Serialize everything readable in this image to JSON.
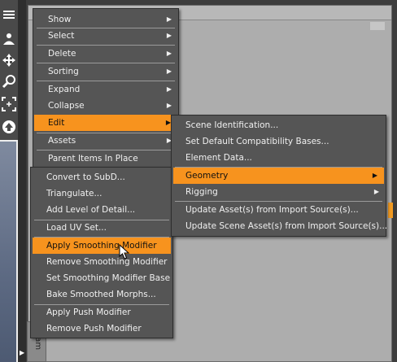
{
  "colors": {
    "menu_bg": "#555555",
    "highlight": "#f7931e",
    "pane_bg": "#adadad"
  },
  "toolbar": {
    "icons": [
      "list-icon",
      "user-move-icon",
      "move-arrows-icon",
      "zoom-icon",
      "frame-icon",
      "up-arrow-icon"
    ]
  },
  "side_tab": {
    "label": "aram"
  },
  "main_menu": {
    "items": [
      {
        "label": "Show",
        "submenu": true
      },
      {
        "label": "Select",
        "submenu": true
      },
      {
        "label": "Delete",
        "submenu": true
      },
      {
        "label": "Sorting",
        "submenu": true
      },
      {
        "label": "Expand",
        "submenu": true
      },
      {
        "label": "Collapse",
        "submenu": true
      },
      {
        "label": "Edit",
        "submenu": true,
        "highlighted": true
      },
      {
        "label": "Assets",
        "submenu": true
      },
      {
        "label": "Parent Items In Place",
        "submenu": false
      }
    ]
  },
  "lower_menu": {
    "items": [
      {
        "label": "Convert to SubD..."
      },
      {
        "label": "Triangulate..."
      },
      {
        "label": "Add Level of Detail..."
      },
      {
        "label": "Load UV Set..."
      },
      {
        "label": "Apply Smoothing Modifier",
        "highlighted": true
      },
      {
        "label": "Remove Smoothing Modifier"
      },
      {
        "label": "Set Smoothing Modifier Base"
      },
      {
        "label": "Bake Smoothed Morphs..."
      },
      {
        "label": "Apply Push Modifier"
      },
      {
        "label": "Remove Push Modifier"
      }
    ]
  },
  "edit_submenu": {
    "items": [
      {
        "label": "Scene Identification..."
      },
      {
        "label": "Set Default Compatibility Bases..."
      },
      {
        "label": "Element Data..."
      },
      {
        "label": "Geometry",
        "submenu": true,
        "highlighted": true
      },
      {
        "label": "Rigging",
        "submenu": true
      },
      {
        "label": "Update Asset(s) from Import Source(s)..."
      },
      {
        "label": "Update Scene Asset(s) from Import Source(s)..."
      }
    ]
  }
}
